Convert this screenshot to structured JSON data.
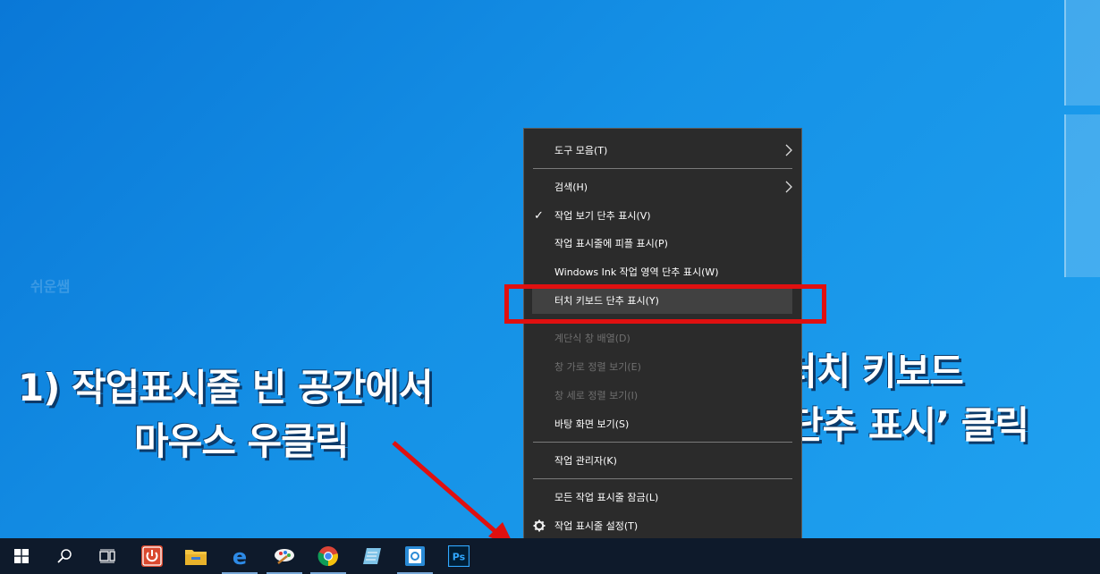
{
  "watermark": "쉬운쌤",
  "annotations": {
    "step1_line1": "1) 작업표시줄 빈 공간에서",
    "step1_line2": "마우스 우클릭",
    "step2_line1": "2) ‘터치 키보드",
    "step2_line2": "단추 표시’ 클릭"
  },
  "context_menu": {
    "items": [
      {
        "label": "도구 모음(T)",
        "submenu": true
      },
      {
        "label": "검색(H)",
        "submenu": true
      },
      {
        "label": "작업 보기 단추 표시(V)",
        "checked": true
      },
      {
        "label": "작업 표시줄에 피플 표시(P)"
      },
      {
        "label": "Windows Ink 작업 영역 단추 표시(W)"
      },
      {
        "label": "터치 키보드 단추 표시(Y)",
        "highlighted": true
      },
      {
        "label": "계단식 창 배열(D)",
        "disabled": true
      },
      {
        "label": "창 가로 정렬 보기(E)",
        "disabled": true
      },
      {
        "label": "창 세로 정렬 보기(I)",
        "disabled": true
      },
      {
        "label": "바탕 화면 보기(S)"
      },
      {
        "label": "작업 관리자(K)"
      },
      {
        "label": "모든 작업 표시줄 잠금(L)"
      },
      {
        "label": "작업 표시줄 설정(T)",
        "icon": "gear-icon"
      }
    ]
  },
  "taskbar": {
    "icons": [
      "windows-start-icon",
      "search-icon",
      "task-view-icon",
      "power-app-icon",
      "file-explorer-icon",
      "edge-icon",
      "paint-icon",
      "chrome-icon",
      "notepad-icon",
      "scanner-app-icon",
      "photoshop-icon"
    ],
    "photoshop_label": "Ps"
  },
  "colors": {
    "desktop": "#1591e6",
    "menu_bg": "#2b2b2b",
    "highlight": "#414141",
    "callout_red": "#e01010",
    "taskbar": "#0e1a2b"
  }
}
